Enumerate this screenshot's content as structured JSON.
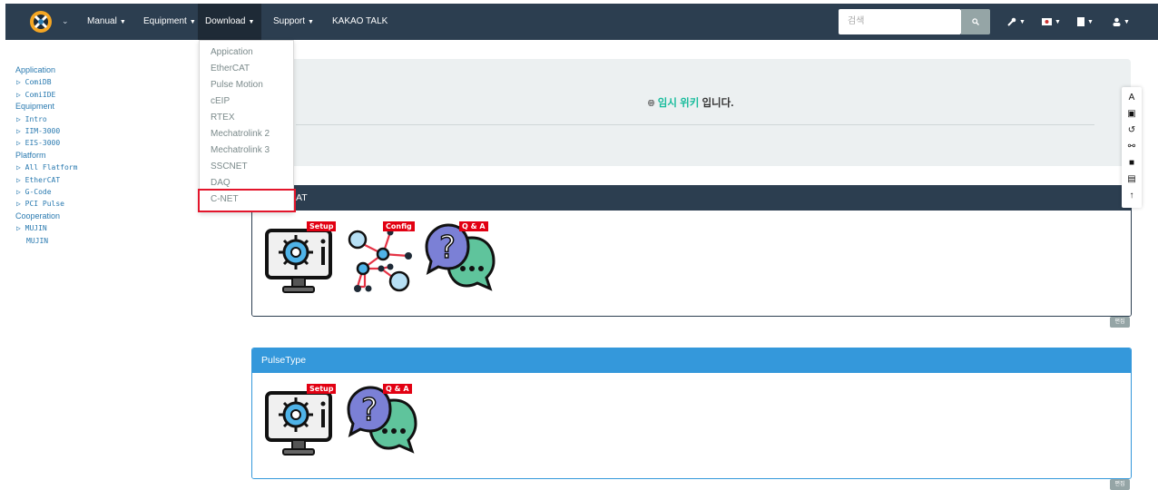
{
  "navbar": {
    "menus": [
      {
        "label": "Manual"
      },
      {
        "label": "Equipment"
      },
      {
        "label": "Download"
      },
      {
        "label": "Support"
      },
      {
        "label": "KAKAO TALK"
      }
    ],
    "search_placeholder": "검색"
  },
  "download_menu": {
    "items": [
      "Appication",
      "EtherCAT",
      "Pulse Motion",
      "cEIP",
      "RTEX",
      "Mechatrolink 2",
      "Mechatrolink 3",
      "SSCNET",
      "DAQ",
      "C-NET"
    ],
    "highlighted": "C-NET"
  },
  "sidebar": {
    "sections": [
      {
        "title": "Application",
        "links": [
          "ComiDB",
          "ComiIDE"
        ]
      },
      {
        "title": "Equipment",
        "links": [
          "Intro",
          "IIM-3000",
          "EIS-3000"
        ]
      },
      {
        "title": "Platform",
        "links": [
          "All Flatform",
          "EtherCAT",
          "G-Code",
          "PCI Pulse"
        ]
      },
      {
        "title": "Cooperation",
        "links": [
          "MUJIN"
        ],
        "plain": [
          "MUJIN"
        ]
      }
    ]
  },
  "notice": {
    "link_text": "임시 위키",
    "suffix": " 입니다."
  },
  "panels": [
    {
      "title": "AT",
      "edit_label": "편집",
      "tags": [
        "Setup",
        "Config",
        "Q & A"
      ]
    },
    {
      "title": "PulseType",
      "edit_label": "편집",
      "tags": [
        "Setup",
        "Q & A"
      ]
    }
  ],
  "colors": {
    "navbar": "#2c3e50",
    "accent_green": "#18bc9c",
    "panel_blue": "#3498db",
    "highlight_red": "#e3152b",
    "tag_red": "#e20012"
  }
}
